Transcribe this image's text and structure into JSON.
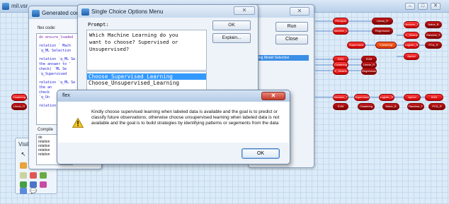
{
  "background": {
    "title": "mil.vsr",
    "controls": [
      "–",
      "□",
      "✕"
    ],
    "node_labels": [
      "Principal",
      "Machine_L",
      "Clustering",
      "Decision_T",
      "Naive_B",
      "Supervised",
      "K_Means",
      "Random_F",
      "Linear_R",
      "Logistic_R",
      "PCA_R",
      "Apriori",
      "KNN",
      "SVM",
      "Clustering",
      "Regression"
    ]
  },
  "palette": {
    "title": "VisiRule"
  },
  "code_window": {
    "title": "Generated code",
    "flex_code_label": "flex code:",
    "code_lines": [
      {
        "text": "do ensure_loaded",
        "kind": "kw"
      },
      {
        "text": "",
        "kind": "gap"
      },
      {
        "text": "relation ` Mach",
        "kind": ""
      },
      {
        "text": "  `q_ML Selection",
        "kind": ""
      },
      {
        "text": "",
        "kind": "gap"
      },
      {
        "text": "relation `q_ML Se",
        "kind": ""
      },
      {
        "text": "  the answer to '",
        "kind": ""
      },
      {
        "text": "  check( `ML Se",
        "kind": ""
      },
      {
        "text": "  `q_Supervised",
        "kind": ""
      },
      {
        "text": "",
        "kind": "gap"
      },
      {
        "text": "relation `q_ML Se",
        "kind": ""
      },
      {
        "text": "  the an",
        "kind": ""
      },
      {
        "text": "  check",
        "kind": ""
      },
      {
        "text": "  `q_Un",
        "kind": ""
      },
      {
        "text": "",
        "kind": "gap"
      },
      {
        "text": "relation",
        "kind": ""
      }
    ],
    "compile_label": "Compile",
    "compile_lines": [
      "do",
      "relation",
      "relation",
      "relation",
      "relation"
    ]
  },
  "choice_window": {
    "title": "Single Choice Options Menu",
    "close_label": "✕",
    "prompt_label": "Prompt:",
    "prompt_text": "Which Machine Learning do you\nwant to choose? Supervised or\nUnsupervised?",
    "options": [
      {
        "label": "Choose_Supervised_Learning",
        "selected": true
      },
      {
        "label": "Choose_Unsupervised_Learning",
        "selected": false
      }
    ],
    "ok_label": "OK",
    "explain_label": "Explain..."
  },
  "mid_window": {
    "close_label": "✕",
    "run_label": "Run",
    "close_button_label": "Close",
    "selection_text": "ning Model Selection"
  },
  "message_dialog": {
    "title": "flex",
    "close_label": "✕",
    "message": "Kindly choose supervised learning when labeled data is available and the goal is to predict or classify future observations; otherwise choose unsupervised learning when labeled data is not available and the goal is to build strategies by identifying patterns or segements from the data",
    "ok_label": "OK"
  }
}
